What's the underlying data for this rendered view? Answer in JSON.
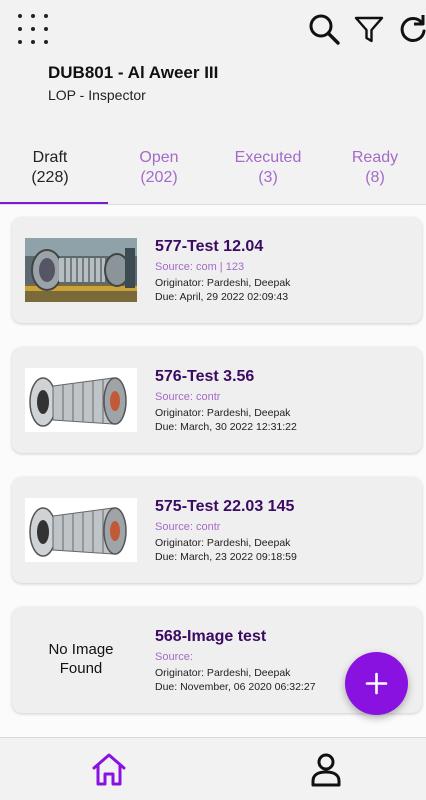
{
  "header": {
    "title": "DUB801 - Al Aweer III",
    "subtitle": "LOP - Inspector"
  },
  "toolbar": {
    "menu_icon": "grid-menu-icon",
    "search_icon": "search-icon",
    "filter_icon": "filter-icon",
    "refresh_icon": "refresh-icon"
  },
  "tabs": [
    {
      "label": "Draft",
      "count": "(228)"
    },
    {
      "label": "Open",
      "count": "(202)"
    },
    {
      "label": "Executed",
      "count": "(3)"
    },
    {
      "label": "Ready",
      "count": "(8)"
    }
  ],
  "cards": [
    {
      "title": "577-Test 12.04",
      "source": "Source: com | 123",
      "originator": "Originator: Pardeshi, Deepak",
      "due": "Due: April, 29 2022 02:09:43",
      "image": "turbine-hall-photo"
    },
    {
      "title": "576-Test 3.56",
      "source": "Source: contr",
      "originator": "Originator: Pardeshi, Deepak",
      "due": "Due: March, 30 2022 12:31:22",
      "image": "gas-turbine-render"
    },
    {
      "title": "575-Test 22.03 145",
      "source": "Source: contr",
      "originator": "Originator: Pardeshi, Deepak",
      "due": "Due: March, 23 2022 09:18:59",
      "image": "gas-turbine-render"
    },
    {
      "title": "568-Image test",
      "source": "Source:",
      "originator": "Originator: Pardeshi, Deepak",
      "due": "Due: November, 06 2020 06:32:27",
      "no_image_line1": "No Image",
      "no_image_line2": "Found"
    }
  ],
  "fab": {
    "icon": "plus-icon"
  },
  "bottom_nav": {
    "home_icon": "home-icon",
    "profile_icon": "user-icon"
  },
  "colors": {
    "accent": "#8a12e0",
    "title": "#3b0a63",
    "muted_purple": "#a46bc8"
  }
}
